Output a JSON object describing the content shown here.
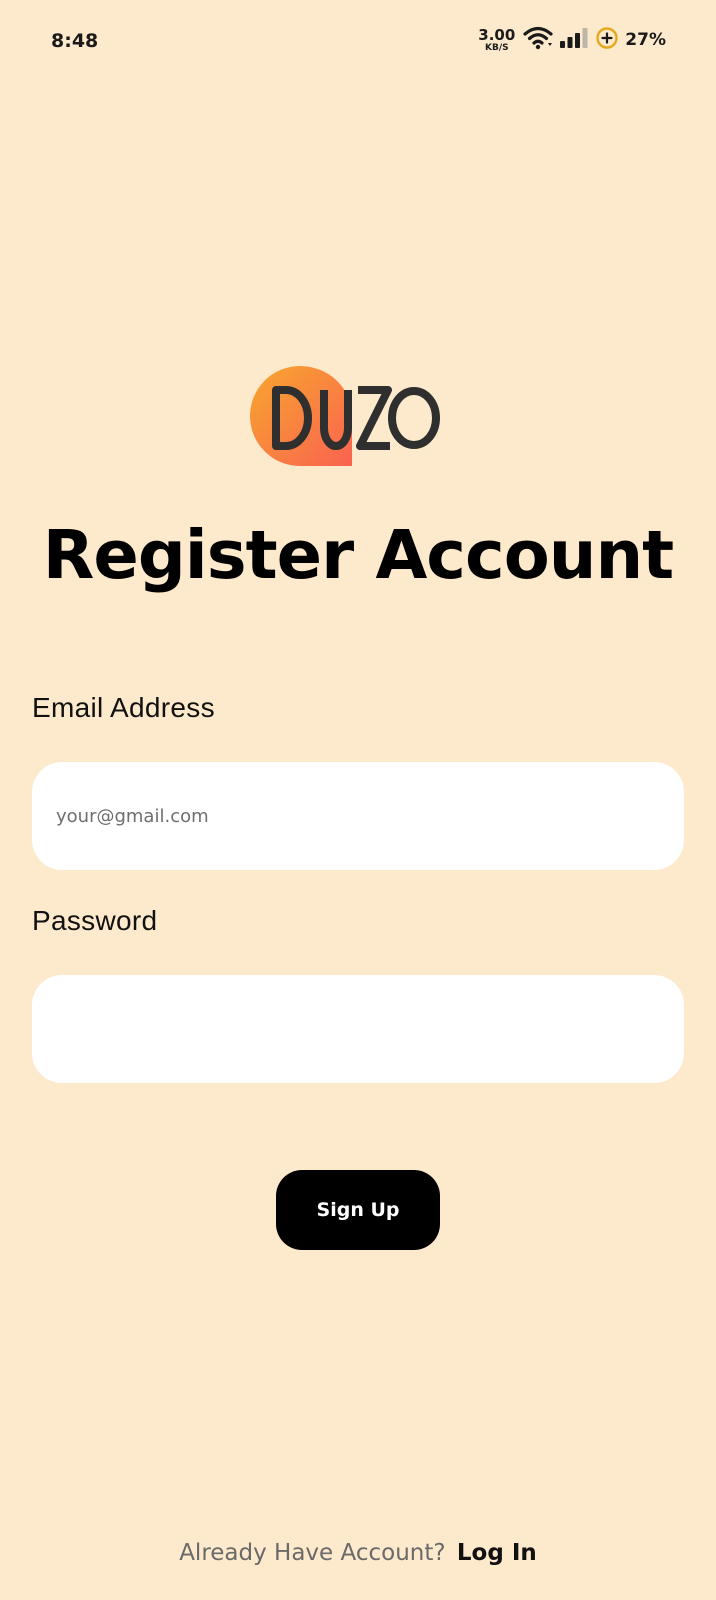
{
  "status_bar": {
    "time": "8:48",
    "net_speed_value": "3.00",
    "net_speed_unit": "KB/S",
    "battery": "27%",
    "icons": [
      "wifi-icon",
      "signal-icon",
      "battery-saver-icon"
    ]
  },
  "logo": {
    "text": "DUZO",
    "colors": {
      "gradient_start": "#F7A72E",
      "gradient_end": "#FA6250",
      "letters": "#2F2F2F"
    }
  },
  "title": "Register Account",
  "form": {
    "email": {
      "label": "Email Address",
      "placeholder": "your@gmail.com",
      "value": ""
    },
    "password": {
      "label": "Password",
      "placeholder": "",
      "value": ""
    },
    "submit_label": "Sign Up"
  },
  "footer": {
    "prompt": "Already Have Account?",
    "link_label": "Log In"
  },
  "colors": {
    "background": "#FDE9CB",
    "input_background": "#FFFFFF",
    "button_background": "#000000",
    "button_text": "#FFFFFF"
  }
}
